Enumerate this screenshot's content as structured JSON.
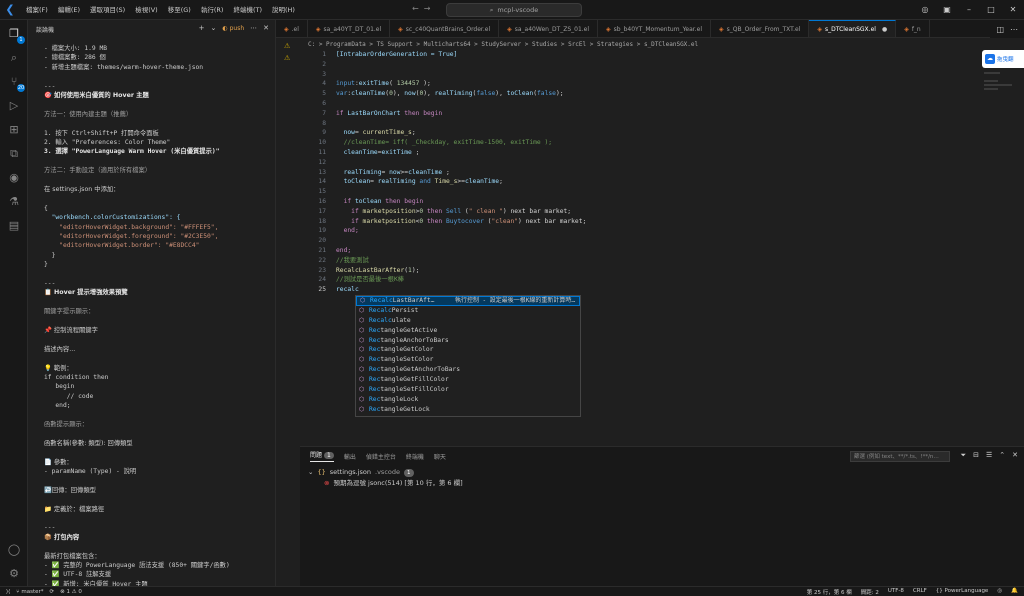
{
  "titlebar": {
    "menu": [
      "檔案(F)",
      "編輯(E)",
      "選取項目(S)",
      "檢視(V)",
      "移至(G)",
      "執行(R)",
      "終端機(T)",
      "說明(H)"
    ],
    "search": "mcpl-vscode"
  },
  "activity": {
    "explorer_badge": "1",
    "scm_badge": "20"
  },
  "sidebar": {
    "title": "談論機",
    "push_label": "push",
    "lines": [
      {
        "t": "- 檔案大小: 1.9 MB",
        "c": "mono"
      },
      {
        "t": "- 總檔案數: 286 個",
        "c": "mono"
      },
      {
        "t": "- 新增主題檔案: themes/warm-hover-theme.json",
        "c": "mono"
      },
      {
        "t": "",
        "c": ""
      },
      {
        "t": "---",
        "c": "mono"
      },
      {
        "t": "🎯 如何使用米白優質的 Hover 主題",
        "c": "h"
      },
      {
        "t": "",
        "c": ""
      },
      {
        "t": "方法一：使用內建主題（推薦）",
        "c": "dim"
      },
      {
        "t": "",
        "c": ""
      },
      {
        "t": "1. 按下 Ctrl+Shift+P 打開命令面板",
        "c": "mono"
      },
      {
        "t": "2. 輸入 \"Preferences: Color Theme\"",
        "c": "mono"
      },
      {
        "t": "3. 選擇 \"PowerLanguage Warm Hover (米白優質提示)\"",
        "c": "mono h"
      },
      {
        "t": "",
        "c": ""
      },
      {
        "t": "方法二：手動設定（適用於所有檔案）",
        "c": "dim"
      },
      {
        "t": "",
        "c": ""
      },
      {
        "t": "在 settings.json 中添加：",
        "c": ""
      },
      {
        "t": "",
        "c": ""
      },
      {
        "t": "{",
        "c": "mono blk"
      },
      {
        "t": "  \"workbench.colorCustomizations\": {",
        "c": "mono key"
      },
      {
        "t": "    \"editorHoverWidget.background\": \"#FFFEF5\",",
        "c": "mono code"
      },
      {
        "t": "    \"editorHoverWidget.foreground\": \"#2C3E50\",",
        "c": "mono code"
      },
      {
        "t": "    \"editorHoverWidget.border\": \"#E8DCC4\"",
        "c": "mono code"
      },
      {
        "t": "  }",
        "c": "mono blk"
      },
      {
        "t": "}",
        "c": "mono blk"
      },
      {
        "t": "",
        "c": ""
      },
      {
        "t": "---",
        "c": "mono"
      },
      {
        "t": "📋 Hover 提示增強效果預覽",
        "c": "h"
      },
      {
        "t": "",
        "c": ""
      },
      {
        "t": "關鍵字提示顯示：",
        "c": "dim"
      },
      {
        "t": "",
        "c": ""
      },
      {
        "t": "📌 控制流程關鍵字",
        "c": ""
      },
      {
        "t": "",
        "c": ""
      },
      {
        "t": "描述內容...",
        "c": ""
      },
      {
        "t": "",
        "c": ""
      },
      {
        "t": "💡 範例：",
        "c": ""
      },
      {
        "t": "if condition then",
        "c": "mono"
      },
      {
        "t": "   begin",
        "c": "mono"
      },
      {
        "t": "      // code",
        "c": "mono"
      },
      {
        "t": "   end;",
        "c": "mono"
      },
      {
        "t": "",
        "c": ""
      },
      {
        "t": "函數提示顯示：",
        "c": "dim"
      },
      {
        "t": "",
        "c": ""
      },
      {
        "t": "函數名稱(參數: 類型): 回傳類型",
        "c": ""
      },
      {
        "t": "",
        "c": ""
      },
      {
        "t": "📄 參數：",
        "c": ""
      },
      {
        "t": "- paramName (Type) - 說明",
        "c": "mono"
      },
      {
        "t": "",
        "c": ""
      },
      {
        "t": "↩️回傳：回傳類型",
        "c": ""
      },
      {
        "t": "",
        "c": ""
      },
      {
        "t": "📁 定義於：檔案路徑",
        "c": ""
      },
      {
        "t": "",
        "c": ""
      },
      {
        "t": "---",
        "c": "mono"
      },
      {
        "t": "📦 打包內容",
        "c": "h"
      },
      {
        "t": "",
        "c": ""
      },
      {
        "t": "最新打包檔案包含：",
        "c": ""
      },
      {
        "t": "- ✅ 完整的 PowerLanguage 語法支援 (850+ 關鍵字/函數)",
        "c": "mono"
      },
      {
        "t": "- ✅ UTF-8 註解支援",
        "c": "mono"
      },
      {
        "t": "- ✅ 新增: 米白優質 Hover 主題",
        "c": "mono"
      },
      {
        "t": "- ✅ 增強: Hover 提示視覺效果 (圖示、顏色)",
        "c": "mono"
      },
      {
        "t": "- ✅ 新增: HOVER-THEME-GUIDE.md 使用指南",
        "c": "mono"
      }
    ]
  },
  "tabs": [
    {
      "label": ".el",
      "active": false
    },
    {
      "label": "sa_a40YT_DT_01.el",
      "active": false
    },
    {
      "label": "sc_c40QuantBrains_Order.el",
      "active": false
    },
    {
      "label": "sa_a40Wen_DT_ZS_01.el",
      "active": false
    },
    {
      "label": "sb_b40YT_Momentum_Year.el",
      "active": false
    },
    {
      "label": "s_QB_Order_From_TXT.el",
      "active": false
    },
    {
      "label": "s_DTCleanSGX.el",
      "active": true
    },
    {
      "label": "f_n",
      "active": false
    }
  ],
  "breadcrumb": "C: > ProgramData > TS Support > Multicharts64 > StudyServer > Studies > SrcEl > Strategies > s_DTCleanSGX.el",
  "editor": {
    "lines": [
      [
        [
          "[IntrabarOrderGeneration = True]",
          "var"
        ]
      ],
      [],
      [],
      [
        [
          "input",
          "kw"
        ],
        [
          ":",
          ""
        ],
        [
          "exitTime",
          "var"
        ],
        [
          "( ",
          ""
        ],
        [
          "134457",
          "num"
        ],
        [
          " );",
          ""
        ]
      ],
      [
        [
          "var",
          "kw"
        ],
        [
          ":",
          ""
        ],
        [
          "cleanTime",
          "var"
        ],
        [
          "(",
          ""
        ],
        [
          "0",
          "num"
        ],
        [
          "), ",
          ""
        ],
        [
          "now",
          "var"
        ],
        [
          "(",
          ""
        ],
        [
          "0",
          "num"
        ],
        [
          "), ",
          ""
        ],
        [
          "realTiming",
          "var"
        ],
        [
          "(",
          ""
        ],
        [
          "false",
          "kw"
        ],
        [
          "), ",
          ""
        ],
        [
          "toClean",
          "var"
        ],
        [
          "(",
          ""
        ],
        [
          "false",
          "kw"
        ],
        [
          ");",
          ""
        ]
      ],
      [],
      [
        [
          "if ",
          "ctl"
        ],
        [
          "LastBarOnChart",
          "var"
        ],
        [
          " then begin",
          "ctl"
        ]
      ],
      [],
      [
        [
          "  now",
          "var"
        ],
        [
          "= ",
          ""
        ],
        [
          "currentTime_s",
          "fn"
        ],
        [
          ";",
          ""
        ]
      ],
      [
        [
          "  //cleanTime= iff( _Checkday, exitTime-1500, exitTime );",
          "cm"
        ]
      ],
      [
        [
          "  cleanTime",
          "var"
        ],
        [
          "=",
          ""
        ],
        [
          "exitTime",
          "var"
        ],
        [
          " ;",
          ""
        ]
      ],
      [],
      [
        [
          "  realTiming",
          "var"
        ],
        [
          "= ",
          ""
        ],
        [
          "now",
          "var"
        ],
        [
          ">=",
          ""
        ],
        [
          "cleanTime",
          "var"
        ],
        [
          " ;",
          ""
        ]
      ],
      [
        [
          "  toClean",
          "var"
        ],
        [
          "= ",
          ""
        ],
        [
          "realTiming",
          "var"
        ],
        [
          " and ",
          "kw"
        ],
        [
          "Time_s",
          "fn"
        ],
        [
          ">=",
          ""
        ],
        [
          "cleanTime",
          "var"
        ],
        [
          ";",
          ""
        ]
      ],
      [],
      [
        [
          "  if ",
          "ctl"
        ],
        [
          "toClean",
          "var"
        ],
        [
          " then begin",
          "ctl"
        ]
      ],
      [
        [
          "    if ",
          "ctl"
        ],
        [
          "marketposition",
          "fn"
        ],
        [
          ">",
          ""
        ],
        [
          "0",
          "num"
        ],
        [
          " then ",
          "ctl"
        ],
        [
          "Sell",
          "kw"
        ],
        [
          " (",
          ""
        ],
        [
          "\" clean \"",
          "str"
        ],
        [
          ") next bar market;",
          ""
        ]
      ],
      [
        [
          "    if ",
          "ctl"
        ],
        [
          "marketposition",
          "fn"
        ],
        [
          "<",
          ""
        ],
        [
          "0",
          "num"
        ],
        [
          " then ",
          "ctl"
        ],
        [
          "Buytocover",
          "kw"
        ],
        [
          " (",
          ""
        ],
        [
          "\"clean\"",
          "str"
        ],
        [
          ") next bar market;",
          ""
        ]
      ],
      [
        [
          "  end;",
          "ctl"
        ]
      ],
      [],
      [
        [
          "end;",
          "ctl"
        ]
      ],
      [
        [
          "//我要測試",
          "cm"
        ]
      ],
      [
        [
          "RecalcLastBarAfter",
          "fn"
        ],
        [
          "(",
          ""
        ],
        [
          "1",
          "num"
        ],
        [
          ");",
          ""
        ]
      ],
      [
        [
          "//測試是否最後一根K棒",
          "cm"
        ]
      ],
      [
        [
          "recalc",
          "var"
        ]
      ]
    ]
  },
  "suggestions": [
    {
      "match": "Recalc",
      "rest": "LastBarAft…",
      "detail": "執行控制 - 設定最後一根K線的重新計算時…",
      "selected": true
    },
    {
      "match": "Recalc",
      "rest": "Persist"
    },
    {
      "match": "Recalc",
      "rest": "ulate"
    },
    {
      "match": "Rec",
      "rest": "tangleGetActive"
    },
    {
      "match": "Rec",
      "rest": "tangleAnchorToBars"
    },
    {
      "match": "Rec",
      "rest": "tangleGetColor"
    },
    {
      "match": "Rec",
      "rest": "tangleSetColor"
    },
    {
      "match": "Rec",
      "rest": "tangleGetAnchorToBars"
    },
    {
      "match": "Rec",
      "rest": "tangleGetFillColor"
    },
    {
      "match": "Rec",
      "rest": "tangleSetFillColor"
    },
    {
      "match": "Rec",
      "rest": "tangleLock"
    },
    {
      "match": "Rec",
      "rest": "tangleGetLock"
    }
  ],
  "panel": {
    "tabs": [
      {
        "label": "問題",
        "count": "1",
        "active": true
      },
      {
        "label": "輸出",
        "active": false
      },
      {
        "label": "偵錯主控台",
        "active": false
      },
      {
        "label": "終端機",
        "active": false
      },
      {
        "label": "聊天",
        "active": false
      }
    ],
    "filter_placeholder": "篩選 (例如 text、**/*.ts、!**/n…",
    "file": "settings.json",
    "file_path": ".vscode",
    "file_count": "1",
    "error": "預期為逗號 jsonc(514) [第 10 行，第 6 欄]"
  },
  "status": {
    "branch": "master*",
    "errors": "1",
    "warnings": "0",
    "position": "第 25 行，第 6 欄",
    "spaces": "間距: 2",
    "encoding": "UTF-8",
    "eol": "CRLF",
    "language": "PowerLanguage"
  },
  "floater": {
    "label": "拖曳翻"
  }
}
